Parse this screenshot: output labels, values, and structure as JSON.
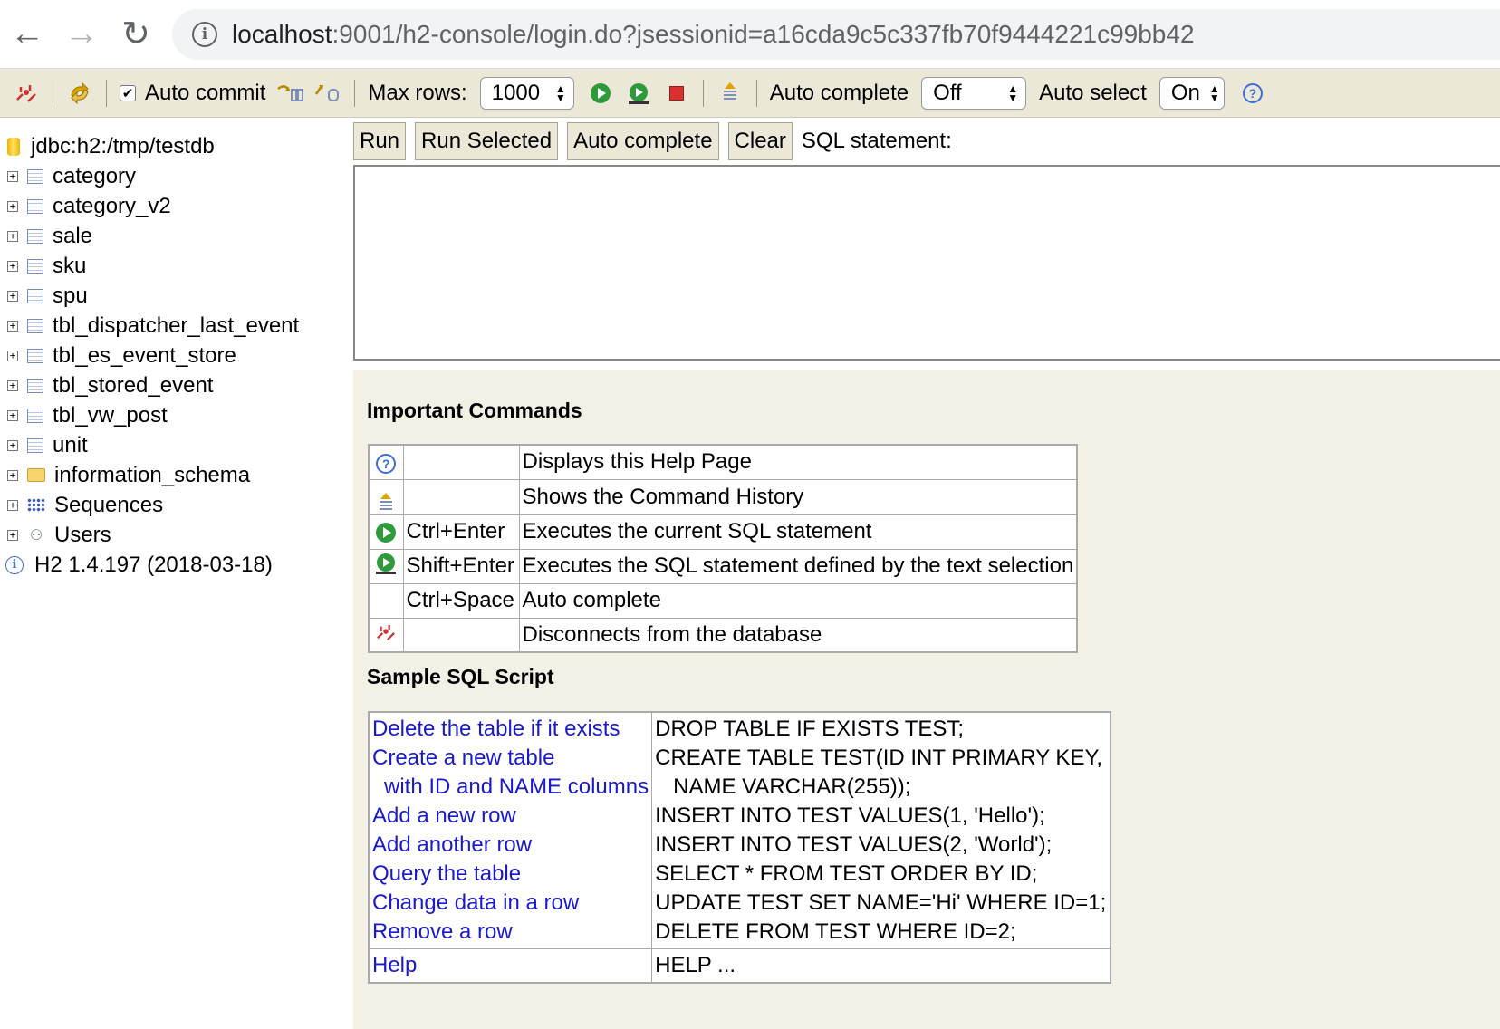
{
  "browser": {
    "back_icon": "←",
    "forward_icon": "→",
    "reload_icon": "↻",
    "url_host": "localhost",
    "url_rest": ":9001/h2-console/login.do?jsessionid=a16cda9c5c337fb70f9444221c99bb42"
  },
  "toolbar": {
    "auto_commit_label": "Auto commit",
    "auto_commit_checked": "✔",
    "max_rows_label": "Max rows:",
    "max_rows_value": "1000",
    "auto_complete_label": "Auto complete",
    "auto_complete_value": "Off",
    "auto_select_label": "Auto select",
    "auto_select_value": "On"
  },
  "tree": {
    "connection": "jdbc:h2:/tmp/testdb",
    "tables": [
      "category",
      "category_v2",
      "sale",
      "sku",
      "spu",
      "tbl_dispatcher_last_event",
      "tbl_es_event_store",
      "tbl_stored_event",
      "tbl_vw_post",
      "unit"
    ],
    "schema": "information_schema",
    "sequences": "Sequences",
    "users": "Users",
    "version": "H2 1.4.197 (2018-03-18)"
  },
  "query": {
    "run": "Run",
    "run_selected": "Run Selected",
    "auto_complete": "Auto complete",
    "clear": "Clear",
    "sql_label": "SQL statement:"
  },
  "help": {
    "important_title": "Important Commands",
    "commands": [
      {
        "icon": "help",
        "key": "",
        "desc": "Displays this Help Page"
      },
      {
        "icon": "history",
        "key": "",
        "desc": "Shows the Command History"
      },
      {
        "icon": "run",
        "key": "Ctrl+Enter",
        "desc": "Executes the current SQL statement"
      },
      {
        "icon": "run-selected",
        "key": "Shift+Enter",
        "desc": "Executes the SQL statement defined by the text selection"
      },
      {
        "icon": "",
        "key": "Ctrl+Space",
        "desc": "Auto complete"
      },
      {
        "icon": "disconnect",
        "key": "",
        "desc": "Disconnects from the database"
      }
    ],
    "sample_title": "Sample SQL Script",
    "sample_links": [
      "Delete the table if it exists",
      "Create a new table",
      "  with ID and NAME columns",
      "Add a new row",
      "Add another row",
      "Query the table",
      "Change data in a row",
      "Remove a row"
    ],
    "sample_sql": [
      "DROP TABLE IF EXISTS TEST;",
      "CREATE TABLE TEST(ID INT PRIMARY KEY,",
      "   NAME VARCHAR(255));",
      "INSERT INTO TEST VALUES(1, 'Hello');",
      "INSERT INTO TEST VALUES(2, 'World');",
      "SELECT * FROM TEST ORDER BY ID;",
      "UPDATE TEST SET NAME='Hi' WHERE ID=1;",
      "DELETE FROM TEST WHERE ID=2;"
    ],
    "help_link": "Help",
    "help_sql": "HELP ..."
  },
  "colors": {
    "toolbar_bg": "#ece8d8",
    "help_bg": "#f3f1e5",
    "link": "#1a1acd"
  }
}
